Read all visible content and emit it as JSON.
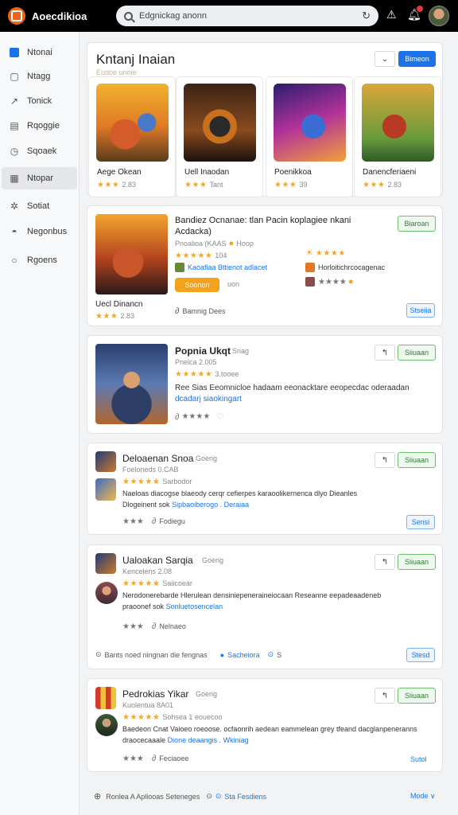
{
  "app": {
    "title": "Aoecdikioa",
    "logo_icon": "app-logo-icon"
  },
  "search": {
    "value": "Edgnickag anonn",
    "placeholder": ""
  },
  "colors": {
    "accent": "#1a73e8",
    "install": "#2e7d32",
    "star": "#f5a623",
    "promo": "#f4a21c"
  },
  "sidebar": {
    "items": [
      {
        "label": "Ntonai",
        "icon": "square-icon"
      },
      {
        "label": "Ntagg",
        "icon": "chat-icon"
      },
      {
        "label": "Tonick",
        "icon": "trend-icon"
      },
      {
        "label": "Rqoggie",
        "icon": "grid-icon"
      },
      {
        "label": "Sqoaek",
        "icon": "bookmark-icon"
      },
      {
        "label": "Ntopar",
        "icon": "calendar-icon"
      },
      {
        "label": "Sotiat",
        "icon": "settings-icon"
      },
      {
        "label": "Negonbus",
        "icon": "location-icon"
      },
      {
        "label": "Rgoens",
        "icon": "circle-icon"
      }
    ],
    "active_index": 5
  },
  "featured": {
    "title": "Kntanj Inaian",
    "subtitle": "Eudoe unoie",
    "button_label": "Bimeon",
    "tiles": [
      {
        "name": "Aege Okean",
        "rating": "★★★",
        "count": "2.83"
      },
      {
        "name": "Uell Inaodan",
        "rating": "★★★",
        "count": "Tant"
      },
      {
        "name": "Poenikkoa",
        "rating": "★★★",
        "count": "39"
      },
      {
        "name": "Danencferiaeni",
        "rating": "★★★",
        "count": "2.83"
      }
    ]
  },
  "promo": {
    "title": "Bandiez Ocnanae: tlan Pacin koplagiee nkani",
    "subtitle": "Acdacka)",
    "meta": "Pnoalioa (KAAS",
    "meta2": "Hoop",
    "rating": "★★★★★",
    "rating_count": "104",
    "dev_line": "Kaoafiaa Bttienot adlacet",
    "dev_icon": "dev-logo-icon",
    "button": "Soonon",
    "tag": "uon",
    "side_rating": "★★★★",
    "side_text": "Horloitichrcocagenac",
    "side_rating2": "★★★★",
    "install": "Biaroan",
    "left_name": "Uecl Dinancn",
    "left_rating": "★★★",
    "left_count": "2.83",
    "footer_text": "Bamnig  Dees",
    "footer_button": "Stseiia"
  },
  "app1": {
    "title": "Popnia Ukqt",
    "badge": "Sriag",
    "subtitle": "Pnelca 2.005",
    "rating": "★★★★★",
    "rating_count": "3.tooee",
    "desc1": "Ree Sias  Eeomnicloe  hadaam  eeonacktare  eeopecdac  oderaadan",
    "desc2": "dcadarj  siaokingart",
    "rate_icons": "★★★★",
    "install": "Siiuaan"
  },
  "app2": {
    "title": "Deloaenan Snoa",
    "badge": "Goeng",
    "subtitle": "Foeloneds 0.CAB",
    "rating": "★★★★★",
    "rating_count": "Sarbodor",
    "desc1": "Naeloas  diacogse  blaeody  cerqr  cefierpes  karaoolikernenca  dlyo  Dieanles",
    "desc2a": "Dlogeinent  sok",
    "desc2b": "Sipbaoiberogo  .  Deraiaa",
    "rate_text": "★★★",
    "footer": "Fodiegu",
    "install": "Siiuaan",
    "side_button": "Sensi"
  },
  "app3": {
    "title": "Ualoakan Sarqia",
    "badge": "Goeng",
    "subtitle": "Kencelens 2.08",
    "rating": "★★★★★",
    "rating_count": "Saiicoear",
    "desc1": "Nerodonerebarde  Hlerulean  densiniepeneraineiocaan  Reseanne  eepadeaadeneb",
    "desc2a": "praoonef  sok",
    "desc2b": "Sonluetosencelan",
    "rate_text": "★★★",
    "footer": "Nelnaeo",
    "install": "Siiuaan",
    "bottom_text": "Bants noed ningnan die fengnas",
    "bottom_link": "Sacheiora",
    "bottom_meta": "S",
    "side_button": "Stesd"
  },
  "app4": {
    "title": "Pedrokias Yikar",
    "badge": "Goeng",
    "subtitle": "Kuolentua 8A01",
    "rating": "★★★★★",
    "rating_count": "Sohsea 1  eouecoo",
    "desc1": "Baedeon  Cnat  Vaioeo  roeoose.  ocfaonrih  aedean  eammelean  grey  tfeand  dacglanpeneranns",
    "desc2a": "draocecaaale",
    "desc2b": "Dione  deaangis  .  Wkiniag",
    "rate_text": "★★★",
    "footer": "Feciaoee",
    "install": "Siiuaan",
    "side_button": "Sutol"
  },
  "bottom_bar": {
    "text": "Ronlea  A  Apliooas  Seteneges",
    "link": "Sta Fesdiens",
    "more": "Mode ∨"
  },
  "icons": {
    "search": "search-icon",
    "refresh": "refresh-icon",
    "warning": "warning-icon",
    "bell": "bell-icon",
    "avatar": "avatar"
  }
}
